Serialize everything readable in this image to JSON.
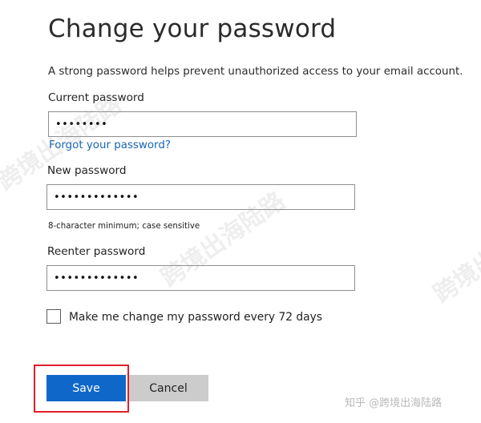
{
  "form": {
    "title": "Change your password",
    "description": "A strong password helps prevent unauthorized access to your email account.",
    "current_password": {
      "label": "Current password",
      "value": "••••••••"
    },
    "forgot_link": "Forgot your password?",
    "new_password": {
      "label": "New password",
      "value": "•••••••••••••",
      "hint": "8-character minimum; case sensitive"
    },
    "reenter_password": {
      "label": "Reenter password",
      "value": "•••••••••••••"
    },
    "expire_checkbox": {
      "label": "Make me change my password every 72 days",
      "checked": false
    },
    "buttons": {
      "save": "Save",
      "cancel": "Cancel"
    }
  },
  "annotation": {
    "highlight_color": "#e01f2a"
  },
  "watermark": {
    "text": "跨境出海陆路",
    "footer": "知乎 @跨境出海陆路"
  },
  "colors": {
    "accent": "#0f68c9",
    "link": "#1765b6",
    "secondary_button": "#cccccc"
  }
}
